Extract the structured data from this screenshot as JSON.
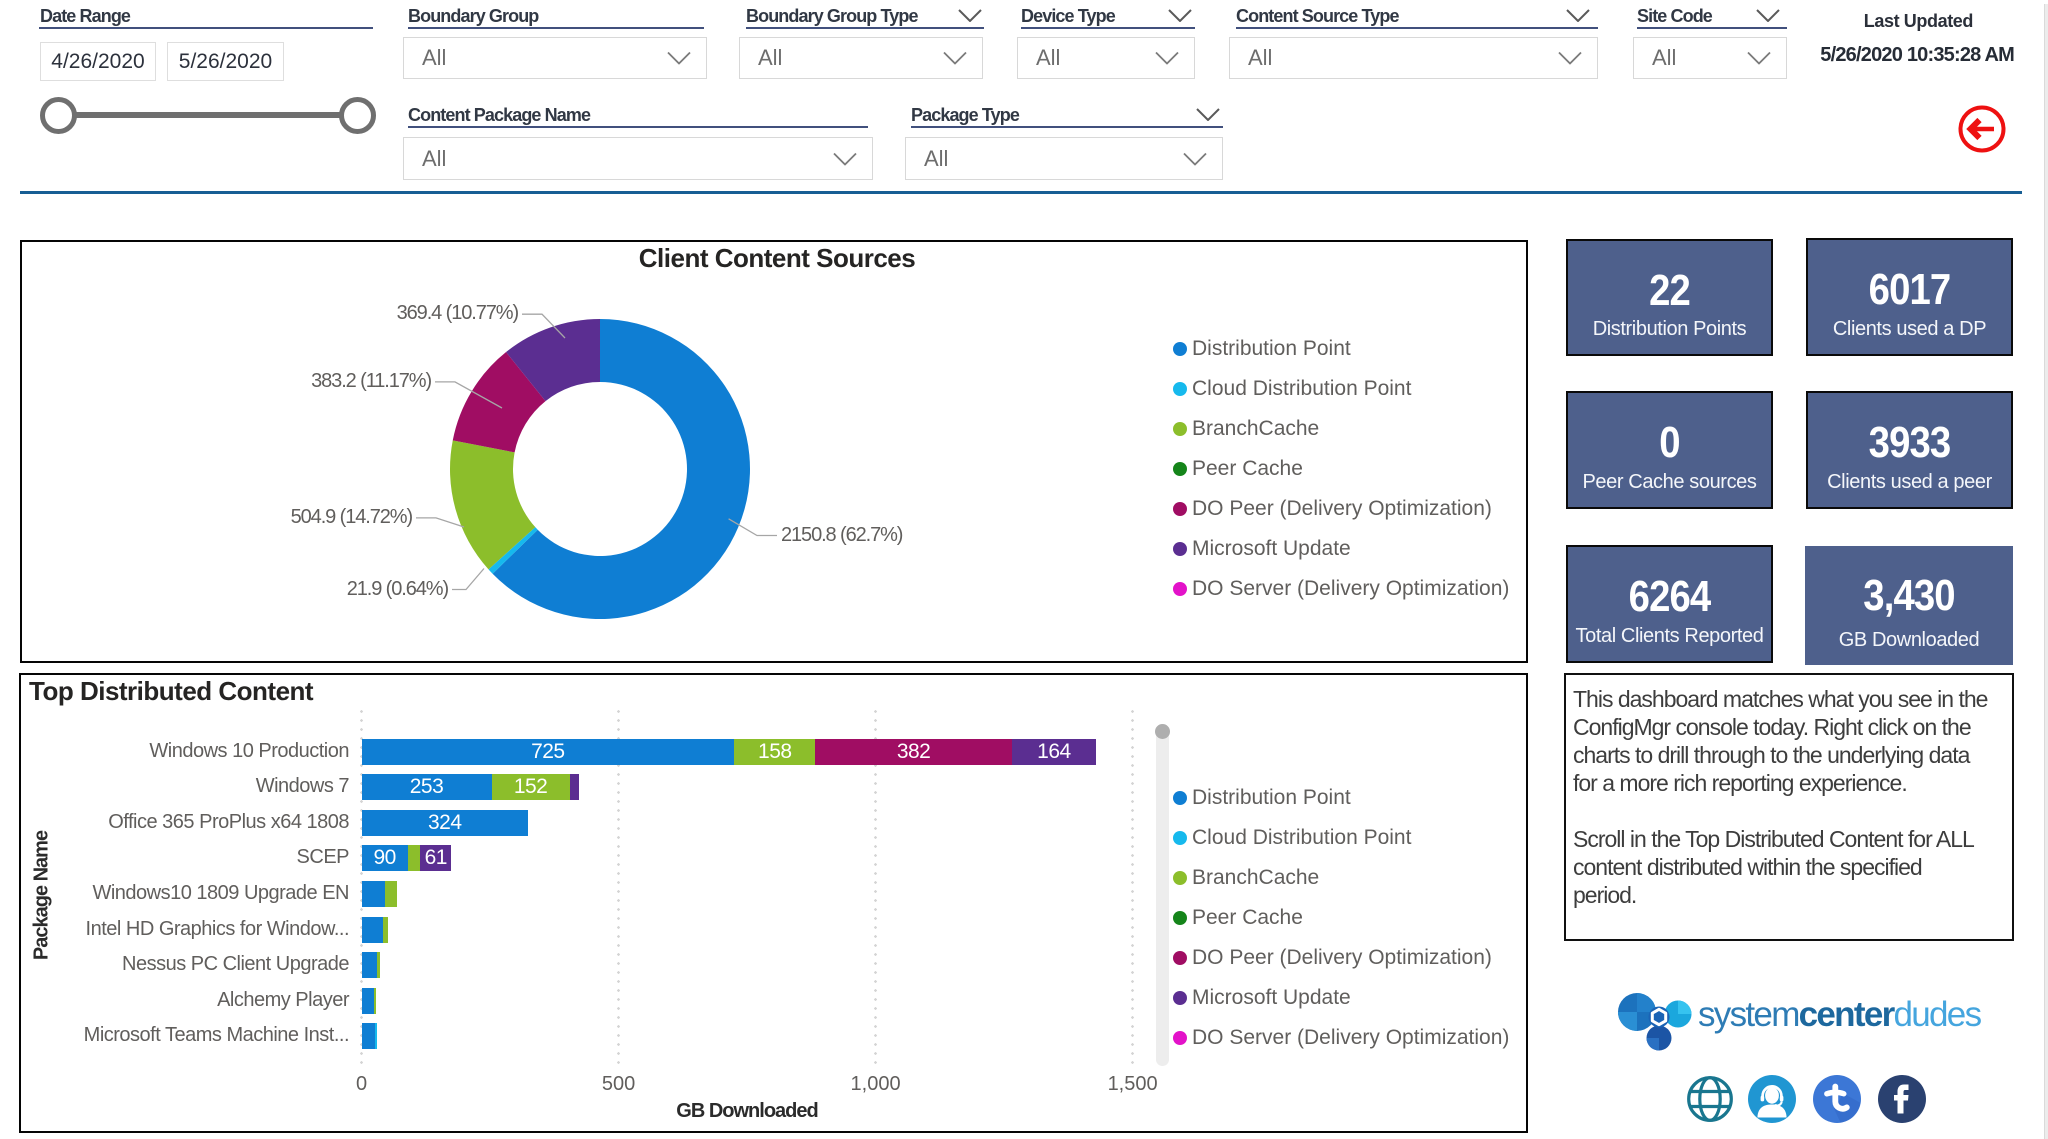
{
  "filters": {
    "date_range": {
      "label": "Date Range",
      "start": "4/26/2020",
      "end": "5/26/2020"
    },
    "boundary_group": {
      "label": "Boundary Group",
      "value": "All"
    },
    "boundary_group_type": {
      "label": "Boundary Group Type",
      "value": "All"
    },
    "device_type": {
      "label": "Device Type",
      "value": "All"
    },
    "content_source_type": {
      "label": "Content Source Type",
      "value": "All"
    },
    "site_code": {
      "label": "Site Code",
      "value": "All"
    },
    "content_package_name": {
      "label": "Content Package Name",
      "value": "All"
    },
    "package_type": {
      "label": "Package Type",
      "value": "All"
    },
    "last_updated": {
      "label": "Last Updated",
      "value": "5/26/2020 10:35:28 AM"
    }
  },
  "colors": {
    "distribution_point": "#0f7ed3",
    "cloud_distribution_point": "#16b9ed",
    "branchcache": "#8cbe2b",
    "peer_cache": "#15851a",
    "do_peer": "#a00d63",
    "microsoft_update": "#5b2e91",
    "do_server": "#e312c9",
    "kpi_background": "#4e608c",
    "separator": "#175e94",
    "back_arrow": "#ee1111"
  },
  "legend": {
    "items": [
      {
        "label": "Distribution Point",
        "color": "#0f7ed3"
      },
      {
        "label": "Cloud Distribution Point",
        "color": "#16b9ed"
      },
      {
        "label": "BranchCache",
        "color": "#8cbe2b"
      },
      {
        "label": "Peer Cache",
        "color": "#15851a"
      },
      {
        "label": "DO Peer (Delivery Optimization)",
        "color": "#a00d63"
      },
      {
        "label": "Microsoft Update",
        "color": "#5b2e91"
      },
      {
        "label": "DO Server (Delivery Optimization)",
        "color": "#e312c9"
      }
    ]
  },
  "chart_data": [
    {
      "type": "pie",
      "title": "Client Content Sources",
      "legend_position": "right",
      "series": [
        {
          "name": "Distribution Point",
          "value": 2150.8,
          "pct": 62.7,
          "callout": "2150.8 (62.7%)",
          "color": "#0f7ed3"
        },
        {
          "name": "Cloud Distribution Point",
          "value": 21.9,
          "pct": 0.64,
          "callout": "21.9 (0.64%)",
          "color": "#16b9ed"
        },
        {
          "name": "BranchCache",
          "value": 504.9,
          "pct": 14.72,
          "callout": "504.9 (14.72%)",
          "color": "#8cbe2b"
        },
        {
          "name": "DO Peer (Delivery Optimization)",
          "value": 383.2,
          "pct": 11.17,
          "callout": "383.2 (11.17%)",
          "color": "#a00d63"
        },
        {
          "name": "Microsoft Update",
          "value": 369.4,
          "pct": 10.77,
          "callout": "369.4 (10.77%)",
          "color": "#5b2e91"
        }
      ]
    },
    {
      "type": "bar",
      "title": "Top Distributed Content",
      "xlabel": "GB Downloaded",
      "ylabel": "Package Name",
      "xlim": [
        0,
        1500
      ],
      "xticks": [
        {
          "value": 0,
          "label": "0"
        },
        {
          "value": 500,
          "label": "500"
        },
        {
          "value": 1000,
          "label": "1,000"
        },
        {
          "value": 1500,
          "label": "1,500"
        }
      ],
      "legend_position": "right",
      "categories": [
        "Windows 10 Production",
        "Windows 7",
        "Office 365 ProPlus x64 1808",
        "SCEP",
        "Windows10 1809 Upgrade EN",
        "Intel HD Graphics for Window...",
        "Nessus PC Client Upgrade",
        "Alchemy Player",
        "Microsoft Teams Machine Inst..."
      ],
      "series": [
        {
          "name": "Distribution Point",
          "color": "#0f7ed3",
          "values": [
            725,
            253,
            324,
            90,
            46,
            41,
            31,
            24,
            27
          ]
        },
        {
          "name": "Cloud Distribution Point",
          "color": "#16b9ed",
          "values": [
            0,
            0,
            0,
            0,
            0,
            0,
            0,
            0,
            4
          ]
        },
        {
          "name": "BranchCache",
          "color": "#8cbe2b",
          "values": [
            158,
            152,
            0,
            24,
            23,
            11,
            5,
            5,
            0
          ]
        },
        {
          "name": "DO Peer (Delivery Optimization)",
          "color": "#a00d63",
          "values": [
            382,
            0,
            0,
            0,
            0,
            0,
            0,
            0,
            0
          ]
        },
        {
          "name": "Microsoft Update",
          "color": "#5b2e91",
          "values": [
            164,
            18,
            0,
            61,
            0,
            0,
            0,
            0,
            0
          ]
        }
      ]
    }
  ],
  "kpis": [
    {
      "value": "22",
      "label": "Distribution Points"
    },
    {
      "value": "6017",
      "label": "Clients used a DP"
    },
    {
      "value": "0",
      "label": "Peer Cache sources"
    },
    {
      "value": "3933",
      "label": "Clients used a peer"
    },
    {
      "value": "6264",
      "label": "Total Clients Reported"
    },
    {
      "value": "3,430",
      "label": "GB Downloaded"
    }
  ],
  "info_box": {
    "lines": [
      "This dashboard matches what you see in the",
      "ConfigMgr console today. Right click on the",
      "charts to drill through to the underlying data",
      "for a more rich reporting experience.",
      "",
      "Scroll in the Top Distributed Content for ALL",
      "content distributed within the specified",
      "period."
    ]
  },
  "logo": {
    "part1": "system",
    "part2": "center",
    "part3": "dudes"
  }
}
